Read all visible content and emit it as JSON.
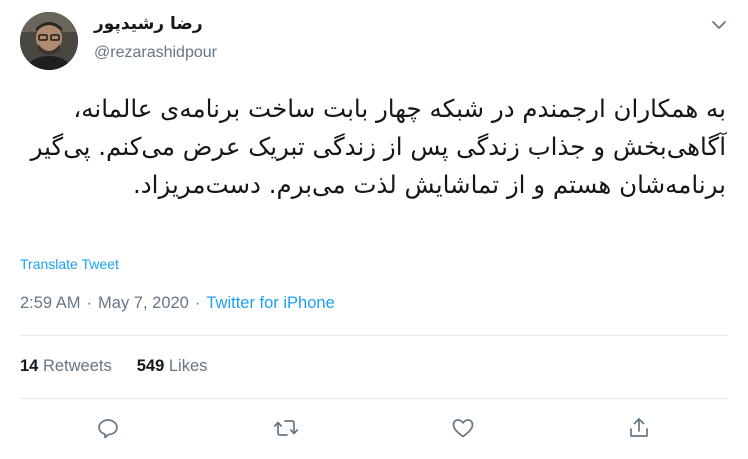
{
  "author": {
    "display_name": "رضا رشیدپور",
    "handle": "@rezarashidpour"
  },
  "tweet": {
    "text": "به همکاران ارجمندم در شبکه چهار بابت ساخت برنامه‌ی عالمانه، آگاهی‌بخش و جذاب زندگی پس از زندگی تبریک عرض می‌کنم. پی‌گیر برنامه‌شان هستم و از تماشایش لذت می‌برم. دست‌مریزاد."
  },
  "translate_label": "Translate Tweet",
  "meta": {
    "time": "2:59 AM",
    "separator1": "·",
    "date": "May 7, 2020",
    "separator2": "·",
    "source": "Twitter for iPhone"
  },
  "stats": {
    "retweets_count": "14",
    "retweets_label": "Retweets",
    "likes_count": "549",
    "likes_label": "Likes"
  },
  "icons": {
    "caret": "chevron-down-icon",
    "reply": "reply-icon",
    "retweet": "retweet-icon",
    "like": "heart-icon",
    "share": "share-icon"
  },
  "colors": {
    "link_blue": "#1da1f2",
    "secondary_text": "#657786",
    "primary_text": "#14171a",
    "divider": "#e6ecf0"
  }
}
